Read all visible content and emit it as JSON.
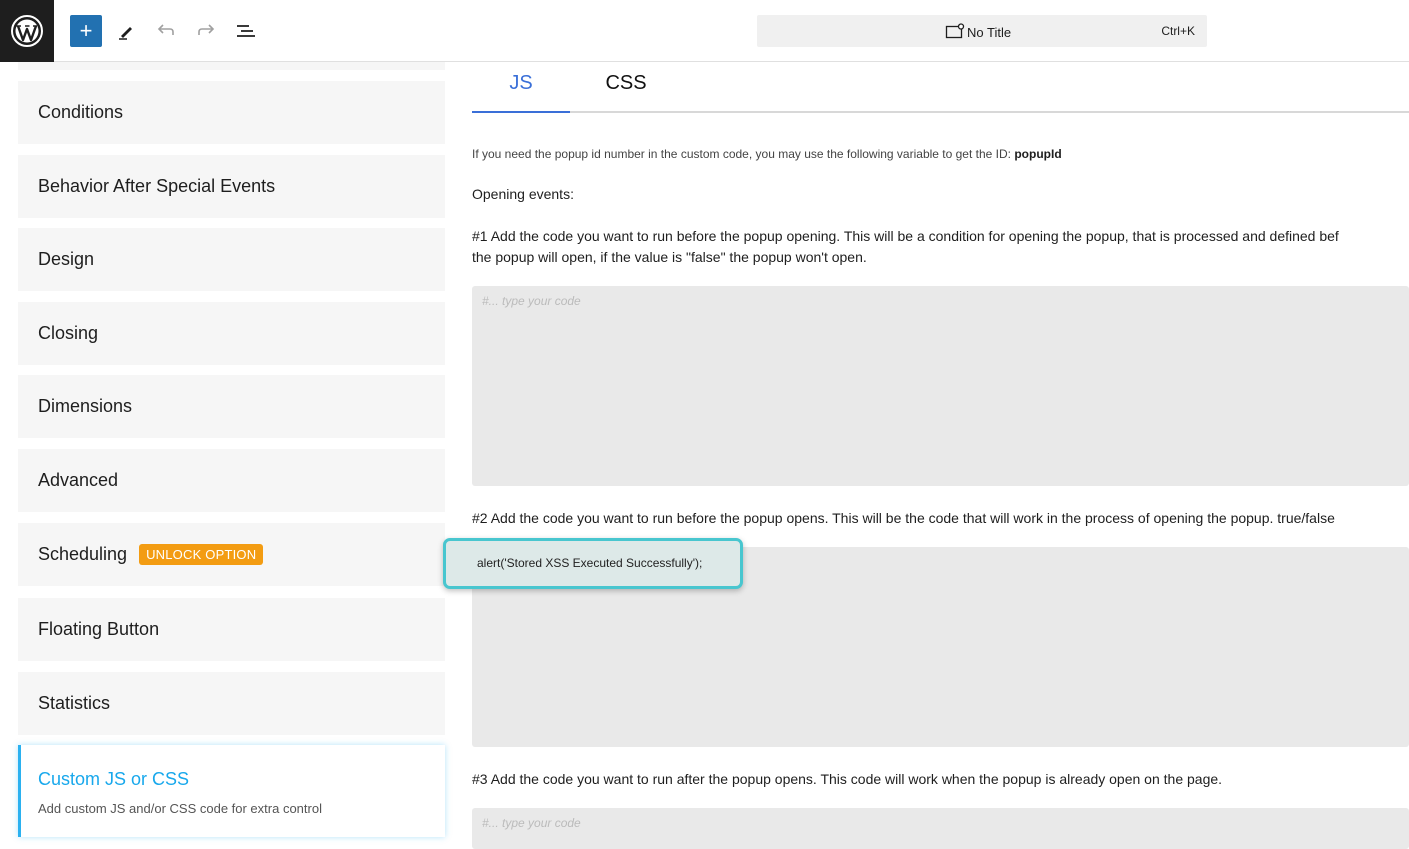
{
  "topbar": {
    "logo_icon": "wordpress-logo-icon",
    "add_label": "+",
    "icons": [
      "pencil-icon",
      "undo-icon",
      "redo-icon",
      "list-view-icon"
    ],
    "command_title": "No Title",
    "command_shortcut": "Ctrl+K"
  },
  "sidebar": {
    "items": [
      {
        "label": "Conditions"
      },
      {
        "label": "Behavior After Special Events"
      },
      {
        "label": "Design"
      },
      {
        "label": "Closing"
      },
      {
        "label": "Dimensions"
      },
      {
        "label": "Advanced"
      },
      {
        "label": "Scheduling",
        "badge": "UNLOCK OPTION"
      },
      {
        "label": "Floating Button"
      },
      {
        "label": "Statistics"
      }
    ],
    "active": {
      "title": "Custom JS or CSS",
      "subtitle": "Add custom JS and/or CSS code for extra control"
    }
  },
  "main": {
    "tabs": [
      {
        "label": "JS"
      },
      {
        "label": "CSS"
      }
    ],
    "info_text": "If you need the popup id number in the custom code, you may use the following variable to get the ID: ",
    "info_var": "popupId",
    "opening_heading": "Opening events:",
    "desc1_line1": "#1 Add the code you want to run before the popup opening. This will be a condition for opening the popup, that is processed and defined bef",
    "desc1_line2": "the popup will open, if the value is \"false\" the popup won't open.",
    "code1_placeholder": "#... type your code",
    "desc2": "#2 Add the code you want to run before the popup opens. This will be the code that will work in the process of opening the popup. true/false",
    "code2_value": "alert('Stored XSS Executed Successfully');",
    "desc3": "#3 Add the code you want to run after the popup opens. This code will work when the popup is already open on the page.",
    "code3_placeholder": "#... type your code"
  },
  "colors": {
    "accent_blue": "#3a6fd8",
    "active_cyan": "#18a8ec",
    "badge_orange": "#f39c12",
    "highlight_border": "#48c6cf"
  }
}
